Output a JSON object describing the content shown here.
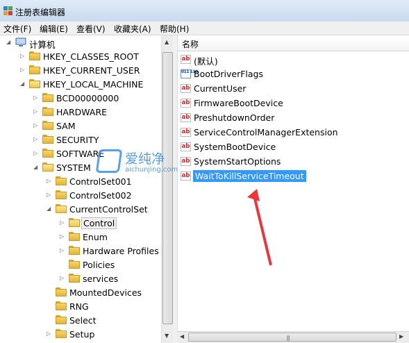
{
  "window": {
    "title": "注册表编辑器"
  },
  "menu": {
    "items": [
      "文件(F)",
      "编辑(E)",
      "查看(V)",
      "收藏夹(A)",
      "帮助(H)"
    ]
  },
  "tree": {
    "root": "计算机",
    "nodes": [
      {
        "label": "HKEY_CLASSES_ROOT"
      },
      {
        "label": "HKEY_CURRENT_USER"
      },
      {
        "label": "HKEY_LOCAL_MACHINE"
      },
      {
        "label": "BCD00000000"
      },
      {
        "label": "HARDWARE"
      },
      {
        "label": "SAM"
      },
      {
        "label": "SECURITY"
      },
      {
        "label": "SOFTWARE"
      },
      {
        "label": "SYSTEM"
      },
      {
        "label": "ControlSet001"
      },
      {
        "label": "ControlSet002"
      },
      {
        "label": "CurrentControlSet"
      },
      {
        "label": "Control"
      },
      {
        "label": "Enum"
      },
      {
        "label": "Hardware Profiles"
      },
      {
        "label": "Policies"
      },
      {
        "label": "services"
      },
      {
        "label": "MountedDevices"
      },
      {
        "label": "RNG"
      },
      {
        "label": "Select"
      },
      {
        "label": "Setup"
      }
    ]
  },
  "values": {
    "column_name": "名称",
    "items": [
      {
        "name": "(默认)",
        "icon": "ab"
      },
      {
        "name": "BootDriverFlags",
        "icon": "binary"
      },
      {
        "name": "CurrentUser",
        "icon": "ab"
      },
      {
        "name": "FirmwareBootDevice",
        "icon": "ab"
      },
      {
        "name": "PreshutdownOrder",
        "icon": "ab"
      },
      {
        "name": "ServiceControlManagerExtension",
        "icon": "ab"
      },
      {
        "name": "SystemBootDevice",
        "icon": "ab"
      },
      {
        "name": "SystemStartOptions",
        "icon": "ab"
      },
      {
        "name": "WaitToKillServiceTimeout",
        "icon": "ab"
      }
    ]
  },
  "icon_text": {
    "string": "ab",
    "binary": "011 110"
  },
  "watermark": {
    "text": "爱纯净",
    "sub": "aichunjing.com"
  },
  "colors": {
    "selection": "#3399ff",
    "annotation_arrow": "#e8383d",
    "watermark": "#3a8ee6"
  }
}
